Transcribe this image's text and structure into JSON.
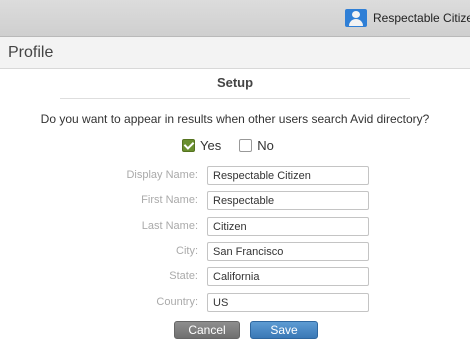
{
  "header": {
    "user_name": "Respectable Citizen",
    "avatar_icon": "user-avatar-icon"
  },
  "profile": {
    "title": "Profile"
  },
  "setup": {
    "title": "Setup",
    "question": "Do you want to appear in results when other users search Avid directory?",
    "yes_label": "Yes",
    "no_label": "No",
    "yes_checked": true,
    "no_checked": false
  },
  "form": {
    "display_name": {
      "label": "Display Name:",
      "value": "Respectable Citizen"
    },
    "first_name": {
      "label": "First Name:",
      "value": "Respectable"
    },
    "last_name": {
      "label": "Last Name:",
      "value": "Citizen"
    },
    "city": {
      "label": "City:",
      "value": "San Francisco"
    },
    "state": {
      "label": "State:",
      "value": "California"
    },
    "country": {
      "label": "Country:",
      "value": "US"
    }
  },
  "actions": {
    "cancel_label": "Cancel",
    "save_label": "Save"
  },
  "colors": {
    "accent_blue": "#3a78b6",
    "checkbox_green": "#6a8f2f"
  }
}
